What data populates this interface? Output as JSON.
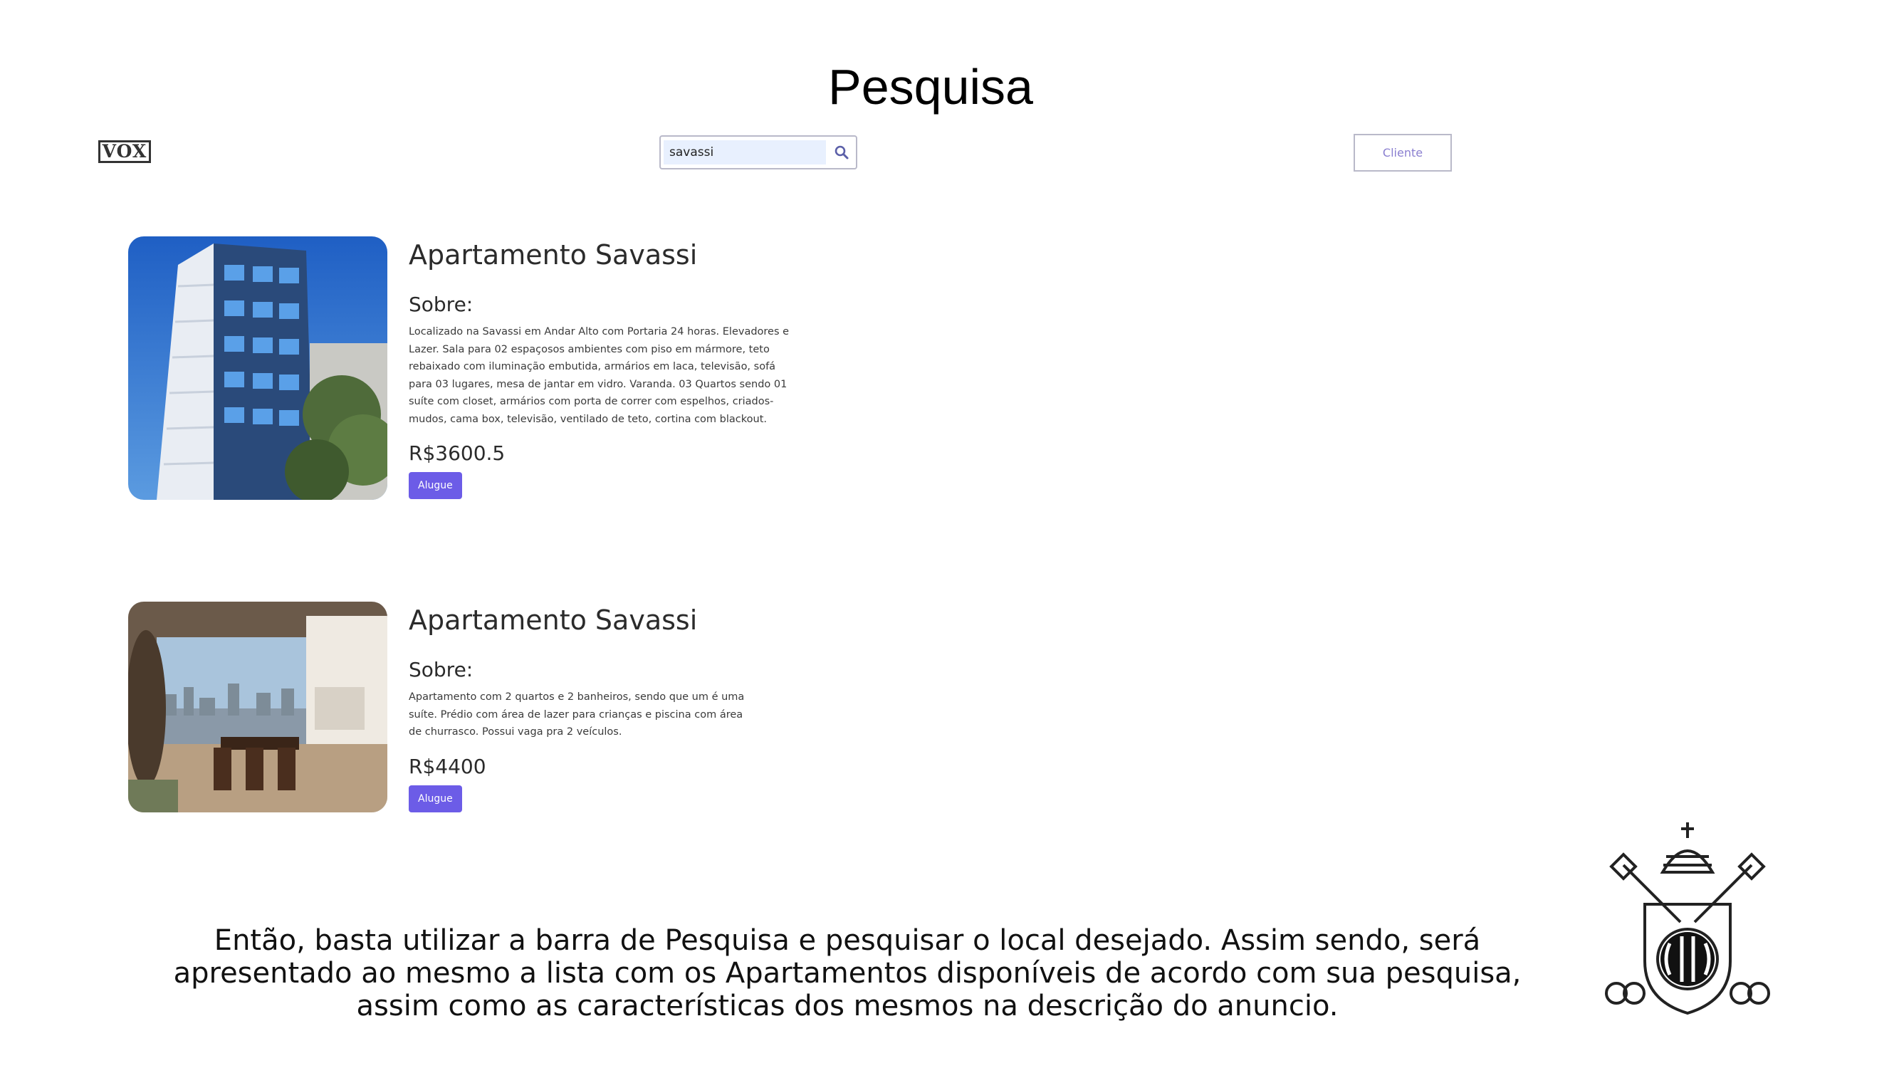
{
  "slide": {
    "title": "Pesquisa",
    "caption": "Então, basta utilizar a barra de Pesquisa e pesquisar o local desejado. Assim sendo, será apresentado ao mesmo a lista com os Apartamentos disponíveis de acordo com sua pesquisa, assim como as características dos mesmos na descrição do anuncio."
  },
  "header": {
    "logo_text": "VOX",
    "search": {
      "value": "savassi",
      "icon": "search-icon"
    },
    "cliente_label": "Cliente"
  },
  "listings": [
    {
      "title": "Apartamento Savassi",
      "about_label": "Sobre:",
      "description": "Localizado na Savassi em Andar Alto com Portaria 24 horas. Elevadores e Lazer. Sala para 02 espaçosos ambientes com piso em mármore, teto rebaixado com iluminação embutida, armários em laca, televisão, sofá para 03 lugares, mesa de jantar em vidro. Varanda. 03 Quartos sendo 01 suíte com closet, armários com porta de correr com espelhos, criados-mudos, cama box, televisão, ventilado de teto, cortina com blackout.",
      "price": "R$3600.5",
      "button_label": "Alugue"
    },
    {
      "title": "Apartamento Savassi",
      "about_label": "Sobre:",
      "description": "Apartamento com 2 quartos e 2 banheiros, sendo que um é uma suíte. Prédio com área de lazer para crianças e piscina com área de churrasco. Possui vaga pra 2 veículos.",
      "price": "R$4400",
      "button_label": "Alugue"
    }
  ],
  "colors": {
    "accent": "#6c5ce7",
    "cliente_text": "#8a7fd0",
    "search_fill": "#e8f0fe"
  }
}
